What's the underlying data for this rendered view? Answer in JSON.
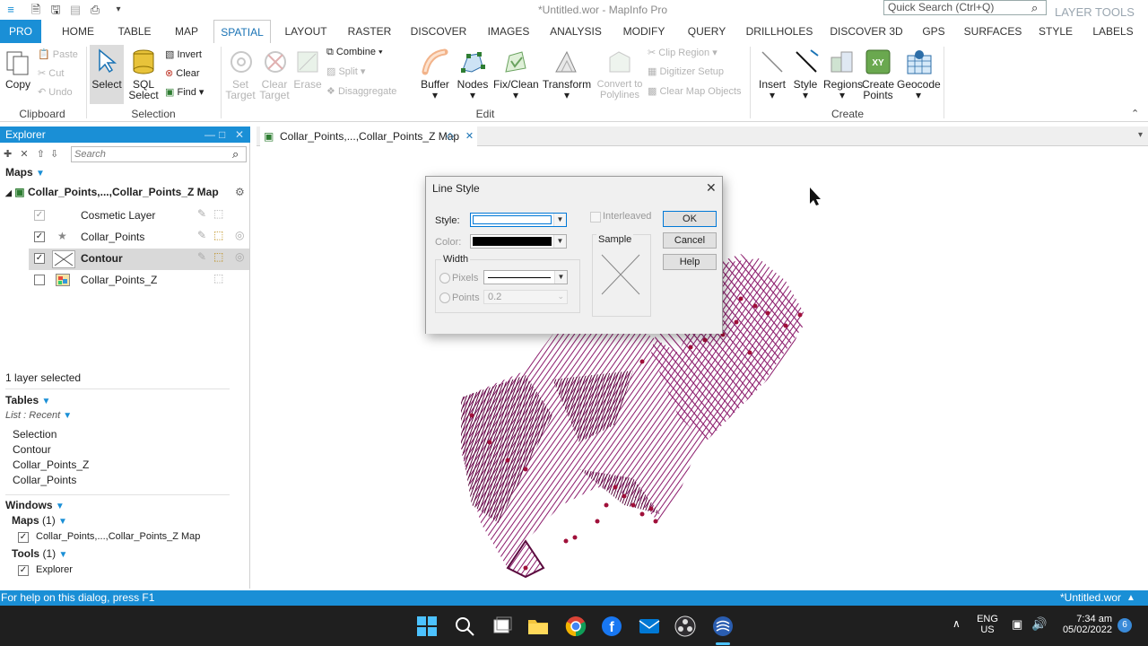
{
  "titlebar": {
    "title": "*Untitled.wor - MapInfo Pro",
    "quick_search_placeholder": "Quick Search (Ctrl+Q)",
    "context_tab": "LAYER TOOLS"
  },
  "tabs": [
    "PRO",
    "HOME",
    "TABLE",
    "MAP",
    "SPATIAL",
    "LAYOUT",
    "RASTER",
    "DISCOVER",
    "IMAGES",
    "ANALYSIS",
    "MODIFY",
    "QUERY",
    "DRILLHOLES",
    "DISCOVER 3D",
    "GPS",
    "SURFACES",
    "STYLE",
    "LABELS"
  ],
  "ribbon": {
    "clipboard": {
      "group": "Clipboard",
      "copy": "Copy",
      "paste": "Paste",
      "cut": "Cut",
      "undo": "Undo"
    },
    "selection": {
      "group": "Selection",
      "select": "Select",
      "sql_select_1": "SQL",
      "sql_select_2": "Select",
      "invert": "Invert",
      "clear": "Clear",
      "find": "Find"
    },
    "edit": {
      "group": "Edit",
      "set_target_1": "Set",
      "set_target_2": "Target",
      "clear_target_1": "Clear",
      "clear_target_2": "Target",
      "erase": "Erase",
      "combine": "Combine",
      "split": "Split",
      "disaggregate": "Disaggregate",
      "buffer": "Buffer",
      "nodes": "Nodes",
      "fix_clean": "Fix/Clean",
      "transform": "Transform",
      "convert_1": "Convert to",
      "convert_2": "Polylines",
      "clip_region": "Clip Region",
      "digitizer_setup": "Digitizer Setup",
      "clear_map_objects": "Clear Map Objects"
    },
    "create": {
      "group": "Create",
      "insert": "Insert",
      "style": "Style",
      "regions": "Regions",
      "create_points_1": "Create",
      "create_points_2": "Points",
      "geocode": "Geocode"
    }
  },
  "explorer": {
    "title": "Explorer",
    "search_placeholder": "Search",
    "maps_header": "Maps",
    "map_name": "Collar_Points,...,Collar_Points_Z Map",
    "layers": [
      {
        "name": "Cosmetic Layer",
        "checked": true
      },
      {
        "name": "Collar_Points",
        "checked": true
      },
      {
        "name": "Contour",
        "checked": true
      },
      {
        "name": "Collar_Points_Z",
        "checked": false
      }
    ],
    "layer_count": "1 layer selected",
    "tables_header": "Tables",
    "list_mode": "List : Recent",
    "tables": [
      "Selection",
      "Contour",
      "Collar_Points_Z",
      "Collar_Points"
    ],
    "windows_header": "Windows",
    "maps_group": "Maps",
    "maps_count": "(1)",
    "map_window": "Collar_Points,...,Collar_Points_Z Map",
    "tools_group": "Tools",
    "tools_count": "(1)",
    "tool_item": "Explorer"
  },
  "map_tab": {
    "title": "Collar_Points,...,Collar_Points_Z Map"
  },
  "dialog": {
    "title": "Line Style",
    "style_label": "Style:",
    "color_label": "Color:",
    "width_label": "Width",
    "pixels_label": "Pixels",
    "points_label": "Points",
    "points_value": "0.2",
    "interleaved_label": "Interleaved",
    "sample_label": "Sample",
    "ok": "OK",
    "cancel": "Cancel",
    "help": "Help"
  },
  "status": {
    "help_text": "For help on this dialog, press F1",
    "workspace": "*Untitled.wor"
  },
  "taskbar": {
    "lang_1": "ENG",
    "lang_2": "US",
    "time": "7:34 am",
    "date": "05/02/2022",
    "badge": "6"
  },
  "colors": {
    "accent": "#1a8fd6",
    "contour": "#8b1a6b",
    "contour_dark": "#5a0a3e"
  }
}
